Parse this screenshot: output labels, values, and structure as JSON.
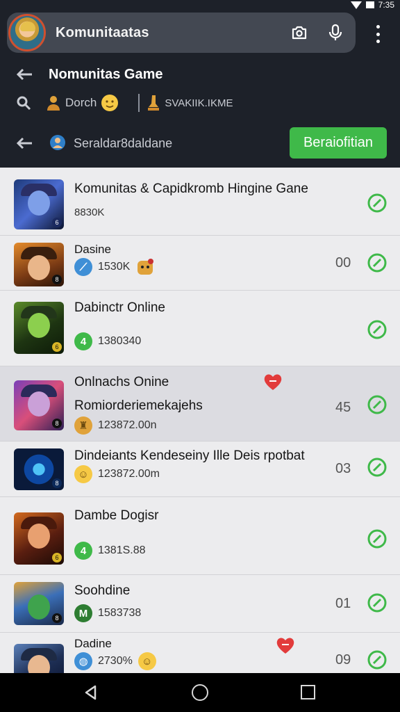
{
  "status_bar": {
    "time": "7:35"
  },
  "search_bar": {
    "title": "Komunitaatas"
  },
  "sub_header": {
    "title": "Nomunitas Game"
  },
  "filter_row": {
    "left_label": "Dorch",
    "right_label": "SVAKIIK.IKME"
  },
  "action_row": {
    "label": "Seraldar8daldane",
    "button_label": "Beraiofitian"
  },
  "items": [
    {
      "name": "Komunitas & Capidkromb Hingine Gane",
      "meta": "8830K"
    },
    {
      "name": "Dasine",
      "meta": "1530K",
      "count": "00"
    },
    {
      "name": "Dabinctr Online",
      "meta": "1380340"
    },
    {
      "name": "Onlnachs Onine",
      "subtitle": "Romiorderiemekajehs",
      "meta": "123872.00n",
      "count": "45"
    },
    {
      "name": "Dindeiants Kendeseiny Ille Deis rpotbat",
      "meta": "123872.00m",
      "count": "03"
    },
    {
      "name": "Dambe Dogisr",
      "meta": "1381S.88"
    },
    {
      "name": "Soohdine",
      "meta": "1583738",
      "count": "01"
    },
    {
      "name": "Dadine",
      "meta": "2730%",
      "count": "09"
    }
  ],
  "colors": {
    "header_bg": "#1d2129",
    "accent_green": "#3fb949",
    "list_bg": "#ececee"
  }
}
